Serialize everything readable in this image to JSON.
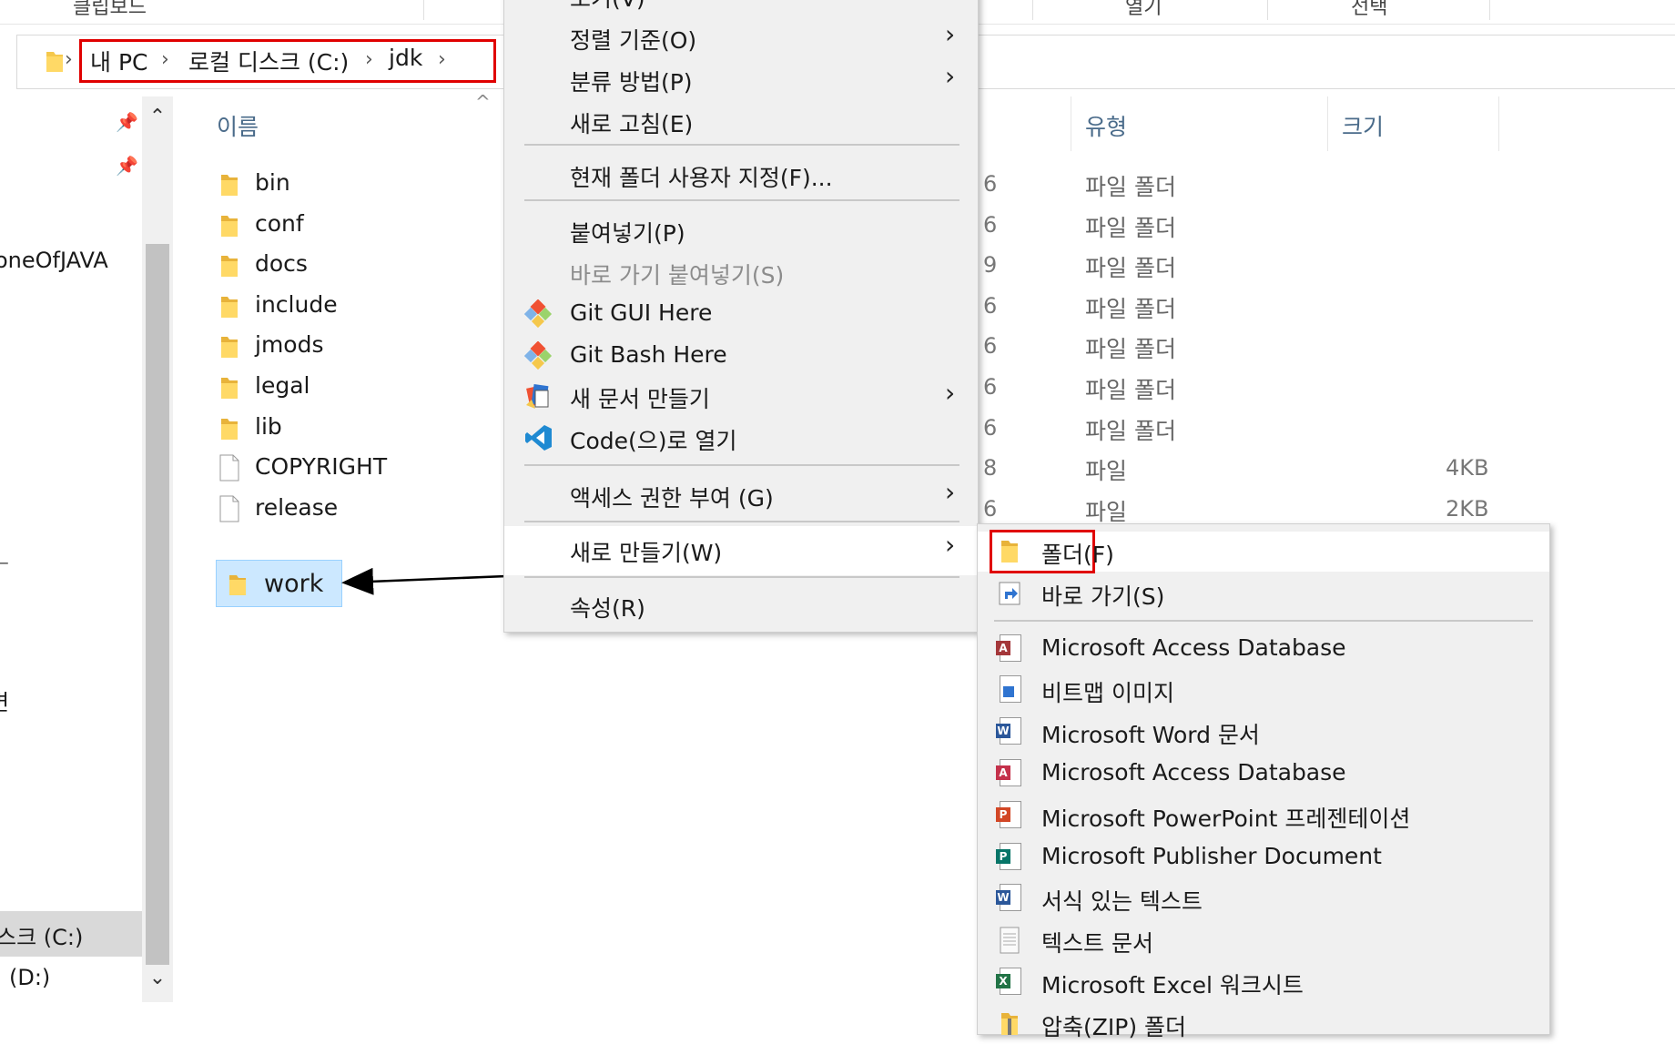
{
  "ribbon": {
    "left_label": "클립보드",
    "right_labels": [
      "열기",
      "선택"
    ]
  },
  "breadcrumb": {
    "items": [
      "내 PC",
      "로컬 디스크 (C:)",
      "jdk"
    ]
  },
  "nav": {
    "items": [
      "oneOfJAVA",
      "ㅡ",
      "변",
      "스크 (C:)",
      "(D:)"
    ]
  },
  "columns": {
    "name": "이름",
    "type": "유형",
    "size": "크기"
  },
  "files": [
    {
      "name": "bin",
      "kind": "folder",
      "date_frag": "6",
      "type": "파일 폴더",
      "size": ""
    },
    {
      "name": "conf",
      "kind": "folder",
      "date_frag": "6",
      "type": "파일 폴더",
      "size": ""
    },
    {
      "name": "docs",
      "kind": "folder",
      "date_frag": "9",
      "type": "파일 폴더",
      "size": ""
    },
    {
      "name": "include",
      "kind": "folder",
      "date_frag": "6",
      "type": "파일 폴더",
      "size": ""
    },
    {
      "name": "jmods",
      "kind": "folder",
      "date_frag": "6",
      "type": "파일 폴더",
      "size": ""
    },
    {
      "name": "legal",
      "kind": "folder",
      "date_frag": "6",
      "type": "파일 폴더",
      "size": ""
    },
    {
      "name": "lib",
      "kind": "folder",
      "date_frag": "6",
      "type": "파일 폴더",
      "size": ""
    },
    {
      "name": "COPYRIGHT",
      "kind": "file",
      "date_frag": "8",
      "type": "파일",
      "size": "4KB"
    },
    {
      "name": "release",
      "kind": "file",
      "date_frag": "6",
      "type": "파일",
      "size": "2KB"
    }
  ],
  "new_folder": {
    "name": "work"
  },
  "context_menu": {
    "top_partial": "보기(V)",
    "items": [
      {
        "label": "정렬 기준(O)",
        "submenu": true
      },
      {
        "label": "분류 방법(P)",
        "submenu": true
      },
      {
        "label": "새로 고침(E)",
        "submenu": false
      },
      {
        "label": "현재 폴더 사용자 지정(F)...",
        "submenu": false
      },
      {
        "label": "붙여넣기(P)",
        "submenu": false
      },
      {
        "label": "바로 가기 붙여넣기(S)",
        "submenu": false,
        "disabled": true
      },
      {
        "label": "Git GUI Here",
        "submenu": false,
        "icon": "git-gui-icon"
      },
      {
        "label": "Git Bash Here",
        "submenu": false,
        "icon": "git-bash-icon"
      },
      {
        "label": "새 문서 만들기",
        "submenu": true,
        "icon": "new-document-icon"
      },
      {
        "label": "Code(으)로 열기",
        "submenu": false,
        "icon": "vscode-icon"
      },
      {
        "label": "액세스 권한 부여 (G)",
        "submenu": true
      },
      {
        "label": "새로 만들기(W)",
        "submenu": true,
        "hovered": true
      },
      {
        "label": "속성(R)",
        "submenu": false
      }
    ]
  },
  "new_submenu": {
    "items": [
      {
        "label": "폴더(F)",
        "icon": "folder-icon",
        "highlighted": true
      },
      {
        "label": "바로 가기(S)",
        "icon": "shortcut-icon"
      },
      {
        "label": "Microsoft Access Database",
        "icon": "access-icon"
      },
      {
        "label": "비트맵 이미지",
        "icon": "bitmap-icon"
      },
      {
        "label": "Microsoft Word 문서",
        "icon": "word-icon"
      },
      {
        "label": "Microsoft Access Database",
        "icon": "access-icon"
      },
      {
        "label": "Microsoft PowerPoint 프레젠테이션",
        "icon": "powerpoint-icon"
      },
      {
        "label": "Microsoft Publisher Document",
        "icon": "publisher-icon"
      },
      {
        "label": "서식 있는 텍스트",
        "icon": "rtf-icon"
      },
      {
        "label": "텍스트 문서",
        "icon": "text-document-icon"
      },
      {
        "label": "Microsoft Excel 워크시트",
        "icon": "excel-icon"
      },
      {
        "label": "압축(ZIP) 폴더",
        "icon": "zip-folder-icon"
      }
    ]
  },
  "colors": {
    "highlight_red": "#e00000",
    "selection_blue": "#cce8ff",
    "folder_yellow": "#f5c84c"
  }
}
